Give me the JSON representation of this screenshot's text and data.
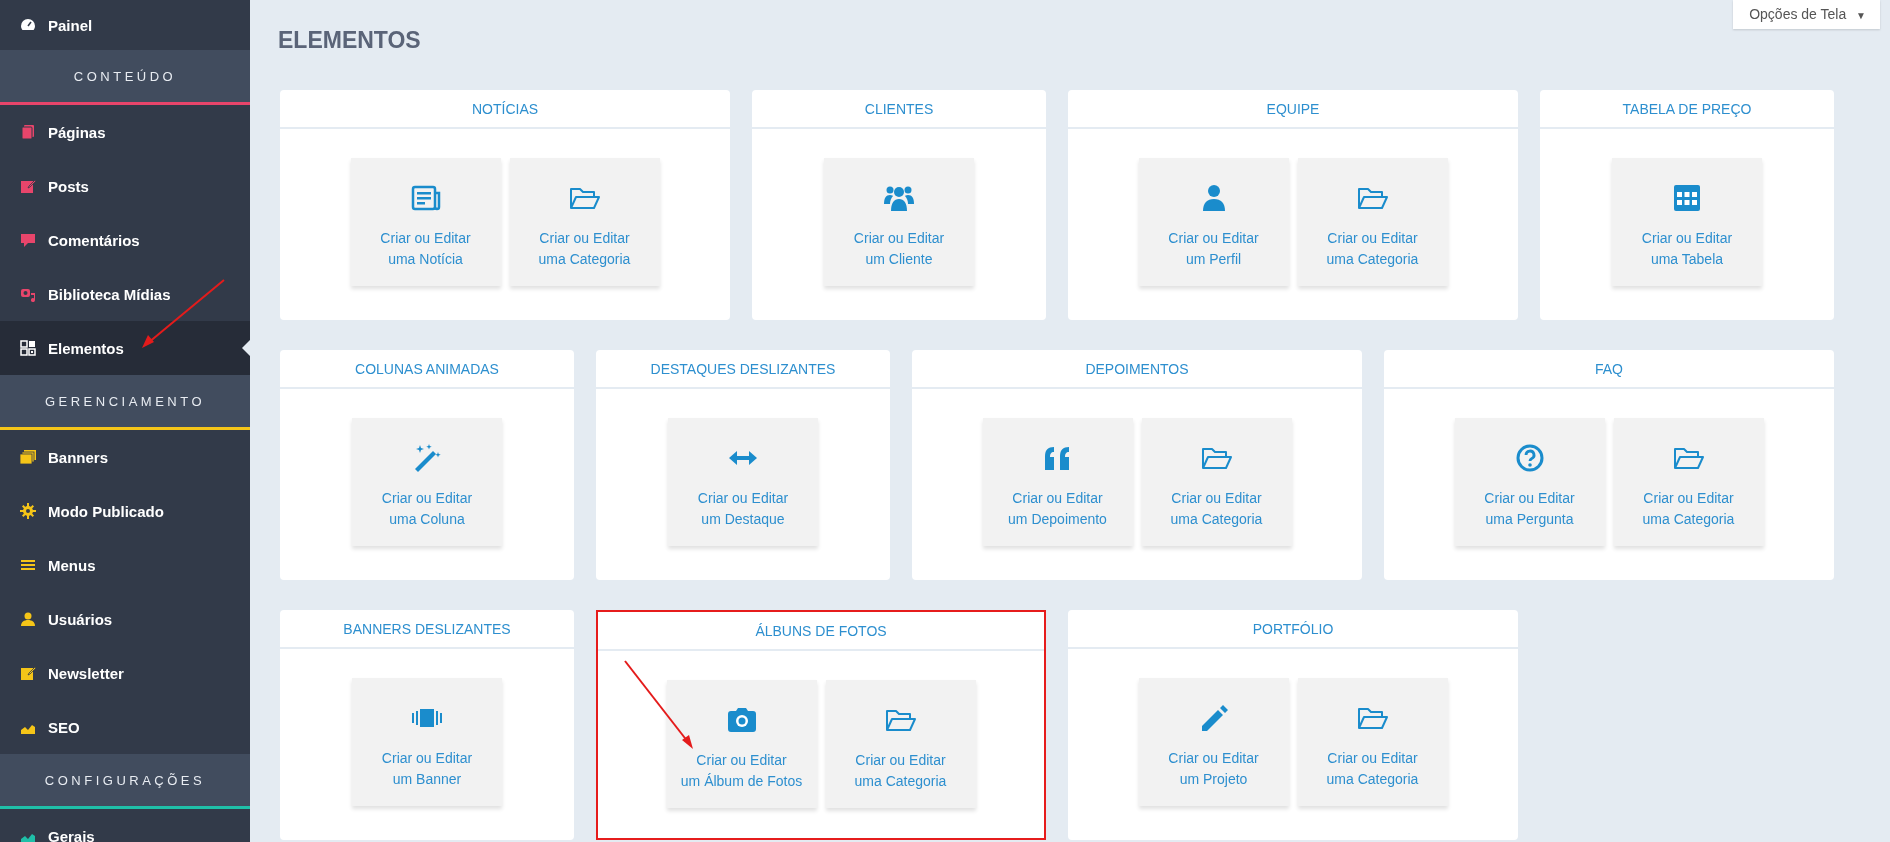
{
  "sidebar": {
    "top_items": [
      {
        "kind": "dashboard",
        "label": "Painel",
        "selected": false
      }
    ],
    "sections": [
      {
        "title": "CONTEÚDO",
        "color": "#e8456b",
        "items": [
          {
            "kind": "pages",
            "label": "Páginas",
            "selected": false,
            "pointed": false
          },
          {
            "kind": "post",
            "label": "Posts",
            "selected": false,
            "pointed": false
          },
          {
            "kind": "comment",
            "label": "Comentários",
            "selected": false,
            "pointed": false
          },
          {
            "kind": "media",
            "label": "Biblioteca Mídias",
            "selected": false,
            "pointed": false
          },
          {
            "kind": "grid",
            "label": "Elementos",
            "selected": true,
            "pointed": true
          }
        ]
      },
      {
        "title": "GERENCIAMENTO",
        "color": "#f5c518",
        "items": [
          {
            "kind": "banners",
            "label": "Banners",
            "selected": false,
            "pointed": false
          },
          {
            "kind": "gear",
            "label": "Modo Publicado",
            "selected": false,
            "pointed": false
          },
          {
            "kind": "menu",
            "label": "Menus",
            "selected": false,
            "pointed": false
          },
          {
            "kind": "user",
            "label": "Usuários",
            "selected": false,
            "pointed": false
          },
          {
            "kind": "post",
            "label": "Newsletter",
            "selected": false,
            "pointed": false
          },
          {
            "kind": "chart",
            "label": "SEO",
            "selected": false,
            "pointed": false
          }
        ]
      },
      {
        "title": "CONFIGURAÇÕES",
        "color": "#1fbfa8",
        "items": [
          {
            "kind": "chart",
            "label": "Gerais",
            "selected": false,
            "pointed": false
          }
        ]
      }
    ]
  },
  "screen_options": {
    "label": "Opções de Tela",
    "caret": "▼"
  },
  "page_title": "ELEMENTOS",
  "rows": [
    {
      "cards": [
        {
          "title": "NOTÍCIAS",
          "highlighted": false,
          "tiles": [
            {
              "kind": "news",
              "label": "Criar ou Editar\numa Notícia",
              "pointed": false
            },
            {
              "kind": "folder",
              "label": "Criar ou Editar\numa Categoria",
              "pointed": false
            }
          ]
        },
        {
          "title": "CLIENTES",
          "highlighted": false,
          "tiles": [
            {
              "kind": "group",
              "label": "Criar ou Editar\num Cliente",
              "pointed": false
            }
          ]
        },
        {
          "title": "EQUIPE",
          "highlighted": false,
          "tiles": [
            {
              "kind": "person",
              "label": "Criar ou Editar\num Perfil",
              "pointed": false
            },
            {
              "kind": "folder",
              "label": "Criar ou Editar\numa Categoria",
              "pointed": false
            }
          ]
        },
        {
          "title": "TABELA DE PREÇO",
          "highlighted": false,
          "tiles": [
            {
              "kind": "table",
              "label": "Criar ou Editar\numa Tabela",
              "pointed": false
            }
          ]
        }
      ]
    },
    {
      "cards": [
        {
          "title": "COLUNAS ANIMADAS",
          "highlighted": false,
          "tiles": [
            {
              "kind": "wand",
              "label": "Criar ou Editar\numa Coluna",
              "pointed": false
            }
          ]
        },
        {
          "title": "DESTAQUES DESLIZANTES",
          "highlighted": false,
          "tiles": [
            {
              "kind": "arrows",
              "label": "Criar ou Editar\num Destaque",
              "pointed": false
            }
          ]
        },
        {
          "title": "DEPOIMENTOS",
          "highlighted": false,
          "tiles": [
            {
              "kind": "quote",
              "label": "Criar ou Editar\num Depoimento",
              "pointed": false
            },
            {
              "kind": "folder",
              "label": "Criar ou Editar\numa Categoria",
              "pointed": false
            }
          ]
        },
        {
          "title": "FAQ",
          "highlighted": false,
          "tiles": [
            {
              "kind": "question",
              "label": "Criar ou Editar\numa Pergunta",
              "pointed": false
            },
            {
              "kind": "folder",
              "label": "Criar ou Editar\numa Categoria",
              "pointed": false
            }
          ]
        }
      ]
    },
    {
      "cards": [
        {
          "title": "BANNERS DESLIZANTES",
          "highlighted": false,
          "tiles": [
            {
              "kind": "slider",
              "label": "Criar ou Editar\num Banner",
              "pointed": false
            }
          ]
        },
        {
          "title": "ÁLBUNS DE FOTOS",
          "highlighted": true,
          "tiles": [
            {
              "kind": "camera",
              "label": "Criar ou Editar\num Álbum de Fotos",
              "pointed": true
            },
            {
              "kind": "folder",
              "label": "Criar ou Editar\numa Categoria",
              "pointed": false
            }
          ]
        },
        {
          "title": "PORTFÓLIO",
          "highlighted": false,
          "tiles": [
            {
              "kind": "pencil",
              "label": "Criar ou Editar\num Projeto",
              "pointed": false
            },
            {
              "kind": "folder",
              "label": "Criar ou Editar\numa Categoria",
              "pointed": false
            }
          ]
        }
      ]
    }
  ]
}
